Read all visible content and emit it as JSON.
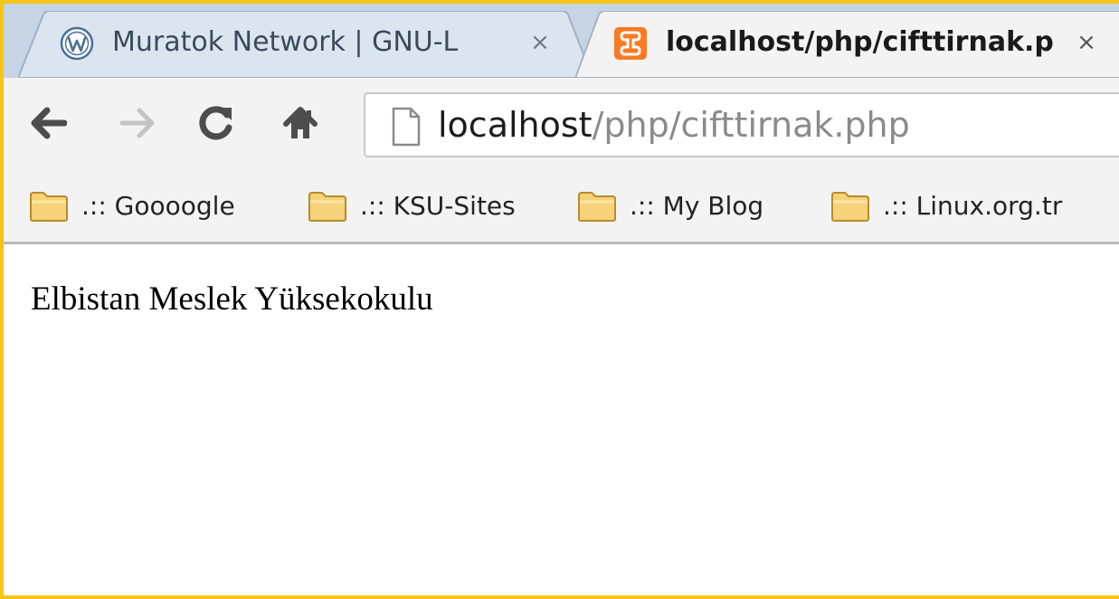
{
  "tabs": [
    {
      "title": "Muratok Network | GNU-L",
      "close": "×",
      "favicon": "wordpress-icon",
      "active": false
    },
    {
      "title": "localhost/php/cifttirnak.p",
      "close": "×",
      "favicon": "xampp-icon",
      "active": true
    }
  ],
  "toolbar": {
    "back": "back-arrow-icon",
    "forward": "forward-arrow-icon",
    "reload": "reload-icon",
    "home": "home-icon"
  },
  "omnibox": {
    "host": "localhost",
    "path": "/php/cifttirnak.php"
  },
  "bookmarks": [
    {
      "label": ".:: Goooogle",
      "icon": "folder-icon"
    },
    {
      "label": ".:: KSU-Sites",
      "icon": "folder-icon"
    },
    {
      "label": ".:: My Blog",
      "icon": "folder-icon"
    },
    {
      "label": ".:: Linux.org.tr",
      "icon": "folder-icon"
    }
  ],
  "page": {
    "text": "Elbistan Meslek Yüksekokulu"
  },
  "colors": {
    "frame_border": "#f5c518",
    "tabstrip": "#c6d4e3",
    "toolbar": "#f3f3f3",
    "url_path": "#8a8a8a",
    "xampp_orange": "#fb7a24"
  }
}
